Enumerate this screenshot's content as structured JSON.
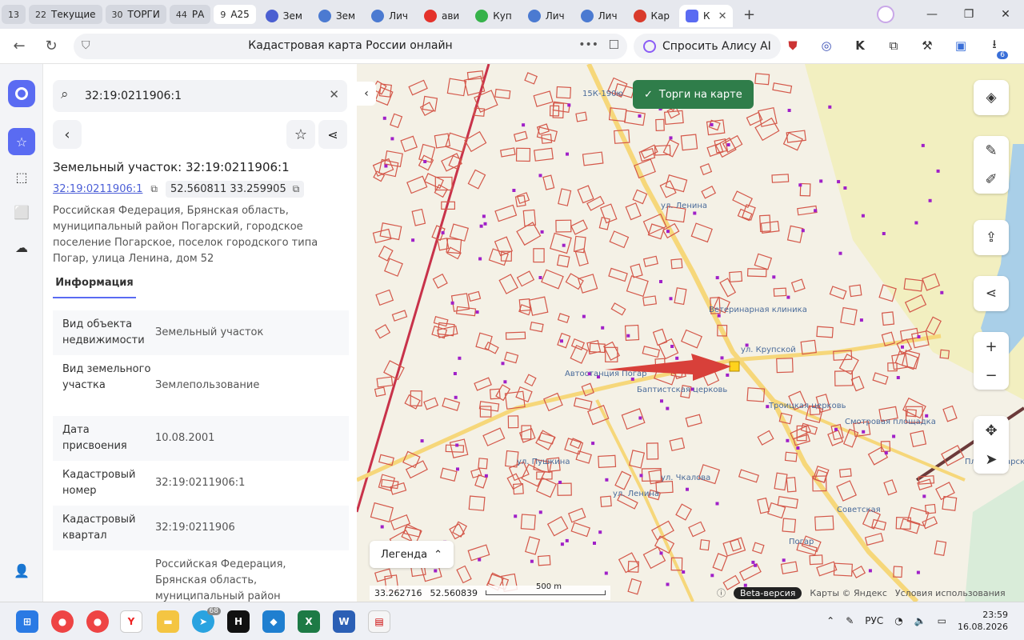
{
  "tabs": [
    {
      "count": "13",
      "label": "",
      "kind": "group"
    },
    {
      "count": "22",
      "label": "Текущие",
      "kind": "group"
    },
    {
      "count": "30",
      "label": "ТОРГИ",
      "kind": "group"
    },
    {
      "count": "44",
      "label": "РА",
      "kind": "group"
    },
    {
      "count": "9",
      "label": "А25",
      "kind": "group"
    },
    {
      "label": "Зем",
      "color": "#4b5fd1"
    },
    {
      "label": "Зем",
      "color": "#4b7ad1"
    },
    {
      "label": "Лич",
      "color": "#4b7ad1"
    },
    {
      "label": "ави",
      "color": "#e4322b"
    },
    {
      "label": "Куп",
      "color": "#36b24a"
    },
    {
      "label": "Лич",
      "color": "#4b7ad1"
    },
    {
      "label": "Лич",
      "color": "#4b7ad1"
    },
    {
      "label": "Кар",
      "color": "#d93a2b"
    },
    {
      "label": "К",
      "color": "#5a6bf2",
      "active": true
    }
  ],
  "address_bar": {
    "title": "Кадастровая карта России онлайн",
    "alice": "Спросить Алису AI"
  },
  "ext_icons": [
    "shield-icon",
    "target-icon",
    "k-icon",
    "puzzle-icon",
    "tools-icon",
    "lock-icon",
    "download-icon"
  ],
  "download_count": "6",
  "panel": {
    "search_value": "32:19:0211906:1",
    "heading": "Земельный участок: 32:19:0211906:1",
    "cad_number_link": "32:19:0211906:1",
    "coords": "52.560811 33.259905",
    "address": "Российская Федерация, Брянская область, муниципальный район Погарский, городское поселение Погарское, поселок городского типа Погар, улица Ленина, дом 52",
    "tab_label": "Информация",
    "rows": [
      {
        "key": "Вид объекта недвижимости",
        "value": "Земельный участок"
      },
      {
        "key": "Вид земельного участка",
        "value": "Землепользование"
      },
      {
        "key": "Дата присвоения",
        "value": "10.08.2001"
      },
      {
        "key": "Кадастровый номер",
        "value": "32:19:0211906:1"
      },
      {
        "key": "Кадастровый квартал",
        "value": "32:19:0211906"
      },
      {
        "key": "",
        "value": "Российская Федерация, Брянская область, муниципальный район"
      }
    ]
  },
  "map": {
    "torgi_button": "Торги на карте",
    "legend": "Легенда",
    "coord_lon": "33.262716",
    "coord_lat": "52.560839",
    "scale": "500 m",
    "beta": "Beta-версия",
    "credits": "Карты © Яндекс",
    "terms": "Условия использования",
    "labels": [
      {
        "text": "15К-190ю"
      },
      {
        "text": "ул. Ленина"
      },
      {
        "text": "Ветеринарная клиника"
      },
      {
        "text": "Автостанция Погар"
      },
      {
        "text": "Баптистская церковь"
      },
      {
        "text": "Троицкая церковь"
      },
      {
        "text": "ул. Крупской"
      },
      {
        "text": "Смотровая площадка"
      },
      {
        "text": "ул. Чкалова"
      },
      {
        "text": "ул. Ленина"
      },
      {
        "text": "Пляж Погарский"
      },
      {
        "text": "Погар"
      },
      {
        "text": "ул. Пушкина"
      },
      {
        "text": "Советская"
      }
    ]
  },
  "taskbar": {
    "lang": "РУС",
    "time": "23:59",
    "date": "16.08.2026",
    "telegram_badge": "68"
  }
}
